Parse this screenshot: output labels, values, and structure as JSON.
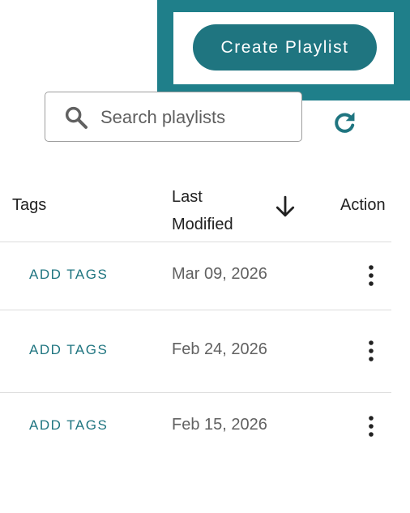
{
  "header": {
    "create_playlist_label": "Create Playlist"
  },
  "search": {
    "placeholder": "Search playlists",
    "value": ""
  },
  "table": {
    "columns": {
      "tags": "Tags",
      "last_modified": "Last Modified",
      "actions": "Action"
    },
    "sort": {
      "column": "last_modified",
      "direction": "descending"
    },
    "rows": [
      {
        "tags_action": "ADD TAGS",
        "last_modified": "Mar 09, 2026"
      },
      {
        "tags_action": "ADD TAGS",
        "last_modified": "Feb 24, 2026"
      },
      {
        "tags_action": "ADD TAGS",
        "last_modified": "Feb 15, 2026"
      }
    ]
  },
  "icons": {
    "search": "search-icon",
    "refresh": "refresh-icon",
    "sort": "arrow-down-icon",
    "row_menu": "more-vertical-icon"
  },
  "colors": {
    "accent": "#1f7580",
    "highlight": "#1f7f8a"
  }
}
